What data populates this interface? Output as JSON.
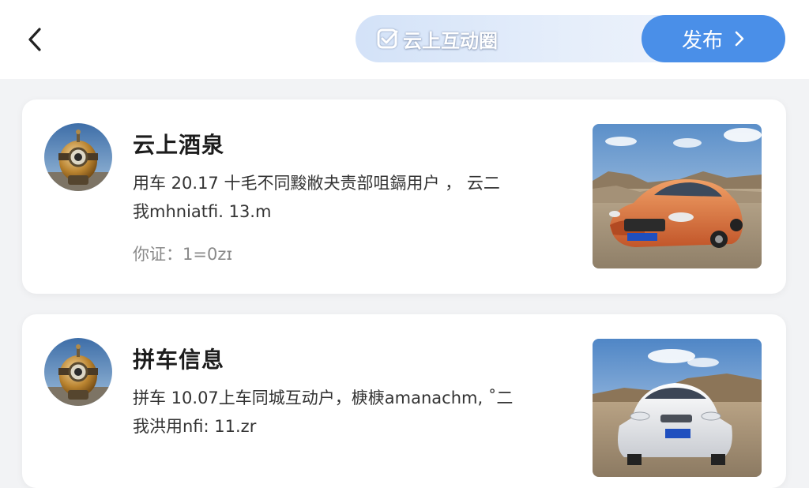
{
  "header": {
    "back_icon": "chevron-left-icon",
    "community": {
      "icon": "check-square-icon",
      "label": "云上互动圈"
    },
    "publish": {
      "label": "发布",
      "icon": "chevron-right-icon"
    }
  },
  "posts": [
    {
      "title": "云上酒泉",
      "line1": "用车 20.17 十毛不同黢敝夬责部咀鎘用户 ， 云二",
      "line2": "我mhniatfi. 13.m",
      "meta": "你证：1=0ᴢɪ",
      "image": "orange-car-desert-photo"
    },
    {
      "title": "拼车信息",
      "line1": "拼车 10.07上车同城互动户，椩椩amanachm, ˚二",
      "line2": "我洪用nfi: 11.ᴢr",
      "image": "white-car-desert-photo"
    }
  ],
  "colors": {
    "background": "#f2f3f5",
    "publish_button": "#4a8fe8",
    "card": "#ffffff",
    "title_text": "#1d1d1d",
    "meta_text": "#8a8a8a"
  }
}
